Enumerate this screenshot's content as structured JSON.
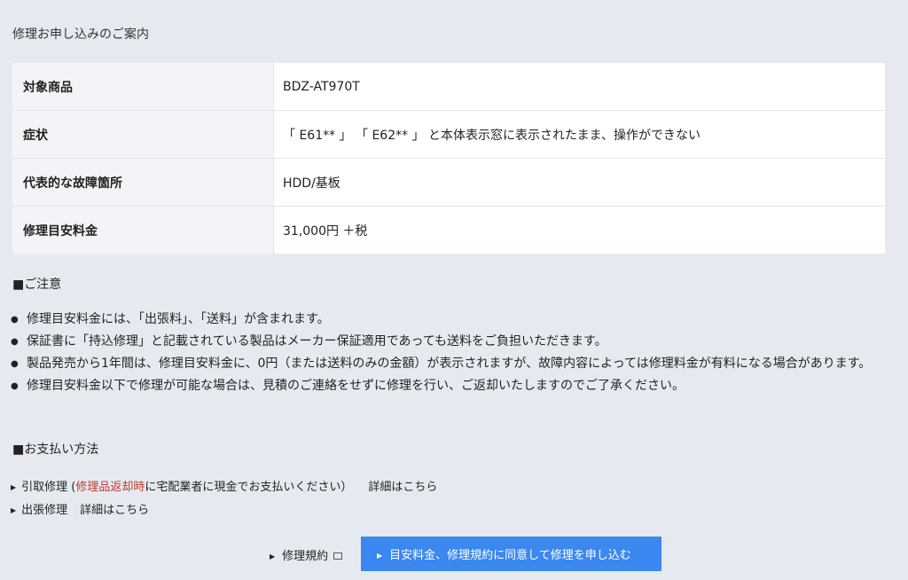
{
  "page_title": "修理お申し込みのご案内",
  "spec_table": [
    {
      "label": "対象商品",
      "value": "BDZ-AT970T"
    },
    {
      "label": "症状",
      "value": "「 E61** 」 「 E62** 」 と本体表示窓に表示されたまま、操作ができない"
    },
    {
      "label": "代表的な故障箇所",
      "value": "HDD/基板"
    },
    {
      "label": "修理目安料金",
      "value": "31,000円 ＋税"
    }
  ],
  "notes_heading": "■ご注意",
  "notes": [
    "修理目安料金には、「出張料」、「送料」が含まれます。",
    "保証書に「持込修理」と記載されている製品はメーカー保証適用であっても送料をご負担いただきます。",
    "製品発売から1年間は、修理目安料金に、0円（または送料のみの金額）が表示されますが、故障内容によっては修理料金が有料になる場合があります。",
    "修理目安料金以下で修理が可能な場合は、見積のご連絡をせずに修理を行い、ご返却いたしますのでご了承ください。"
  ],
  "payment_heading": "■お支払い方法",
  "payment": {
    "pickup_prefix": "引取修理 (",
    "pickup_highlight": "修理品返却時",
    "pickup_suffix": "に宅配業者に現金でお支払いください）",
    "pickup_detail": "詳細はこちら",
    "onsite_label": "出張修理",
    "onsite_detail": "詳細はこちら"
  },
  "terms_label": "修理規約",
  "apply_button_label": "目安料金、修理規約に同意して修理を申し込む",
  "colors": {
    "background": "#e6eaf0",
    "button": "#3a88f0",
    "highlight": "#c0392b"
  }
}
